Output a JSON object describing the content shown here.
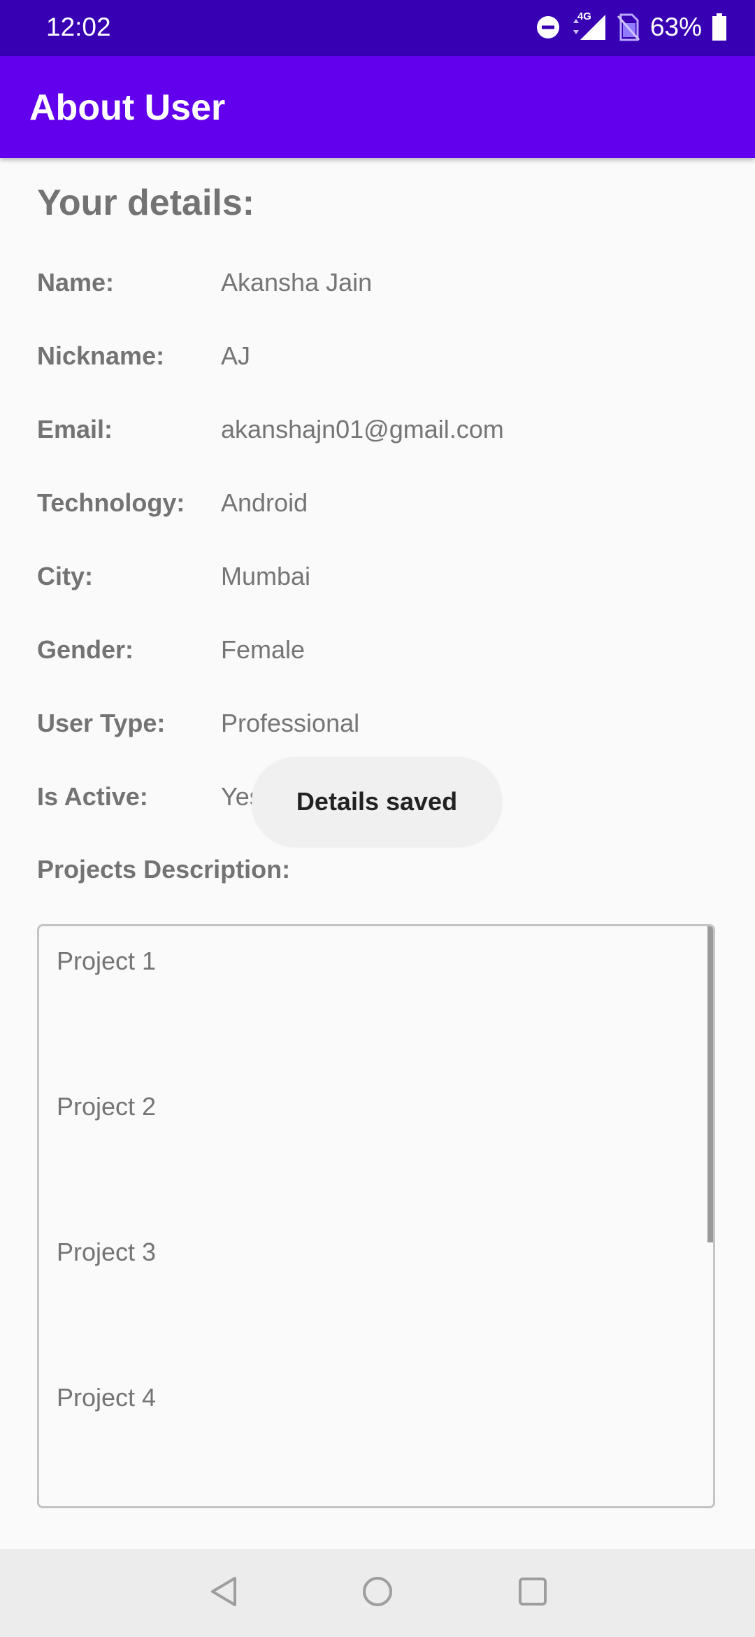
{
  "status_bar": {
    "time": "12:02",
    "network": "4G",
    "battery": "63%",
    "icons": [
      "do-not-disturb-icon",
      "signal-icon",
      "no-sim-icon",
      "battery-icon"
    ]
  },
  "app_bar": {
    "title": "About User",
    "color": "#6200ee",
    "status_color": "#3700b3"
  },
  "details": {
    "title": "Your details:",
    "rows": [
      {
        "label": "Name:",
        "value": "Akansha Jain"
      },
      {
        "label": "Nickname:",
        "value": "AJ"
      },
      {
        "label": "Email:",
        "value": "akanshajn01@gmail.com"
      },
      {
        "label": "Technology:",
        "value": "Android"
      },
      {
        "label": "City:",
        "value": "Mumbai"
      },
      {
        "label": "Gender:",
        "value": "Female"
      },
      {
        "label": "User Type:",
        "value": "Professional"
      },
      {
        "label": "Is Active:",
        "value": "Yes"
      }
    ]
  },
  "projects": {
    "label": "Projects Description:",
    "items": [
      "Project 1",
      "Project 2",
      "Project 3",
      "Project 4"
    ]
  },
  "toast": {
    "message": "Details saved"
  },
  "nav_bar": {
    "icons": [
      "back-icon",
      "home-icon",
      "recents-icon"
    ]
  }
}
